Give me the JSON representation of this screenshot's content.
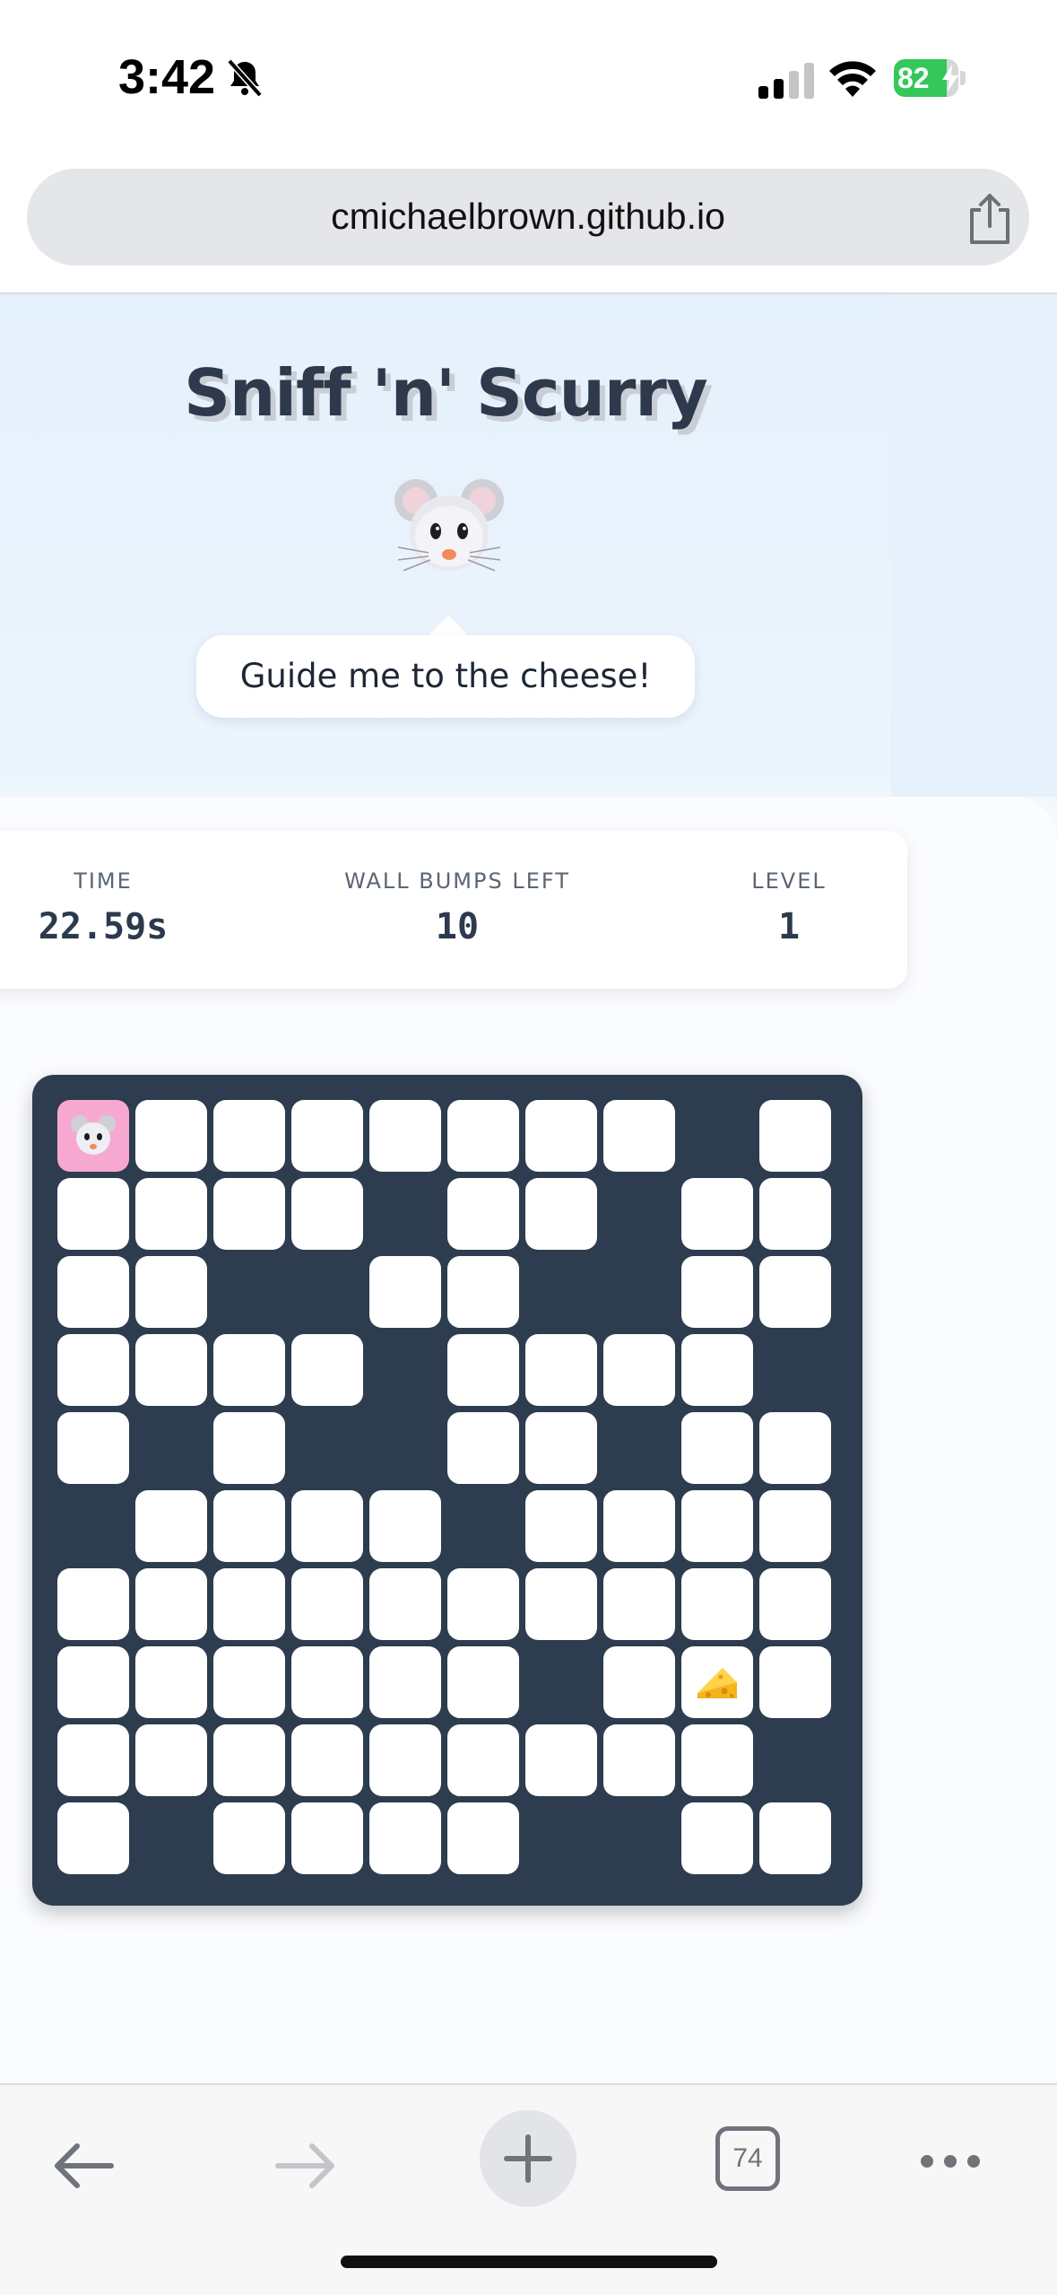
{
  "status_bar": {
    "time": "3:42",
    "battery_level": "82",
    "battery_fraction": 0.82,
    "icons": [
      "bell-slash-icon",
      "cellular-signal-icon",
      "wifi-icon",
      "battery-charging-icon"
    ]
  },
  "browser": {
    "url": "cmichaelbrown.github.io",
    "tab_count": "74",
    "toolbar_icons": [
      "back-arrow-icon",
      "forward-arrow-icon",
      "plus-icon",
      "tabs-icon",
      "more-icon"
    ]
  },
  "game": {
    "title": "Sniff 'n' Scurry",
    "speech": "Guide me to the cheese!",
    "stats": {
      "time_label": "TIME",
      "time_value": "22.59s",
      "bumps_label": "WALL BUMPS LEFT",
      "bumps_value": "10",
      "level_label": "LEVEL",
      "level_value": "1"
    },
    "maze": {
      "size": 10,
      "rows": [
        "1111111101",
        "1111011011",
        "1100110011",
        "1111011110",
        "1010011011",
        "0111101111",
        "1111111111",
        "1111110111",
        "1111111110",
        "1011110011"
      ],
      "player": [
        0,
        0
      ],
      "cheese": [
        7,
        8
      ]
    },
    "colors": {
      "maze_wall": "#2d3c4e",
      "path_tile": "#ffffff",
      "player_tile": "#f7a8d0"
    }
  }
}
